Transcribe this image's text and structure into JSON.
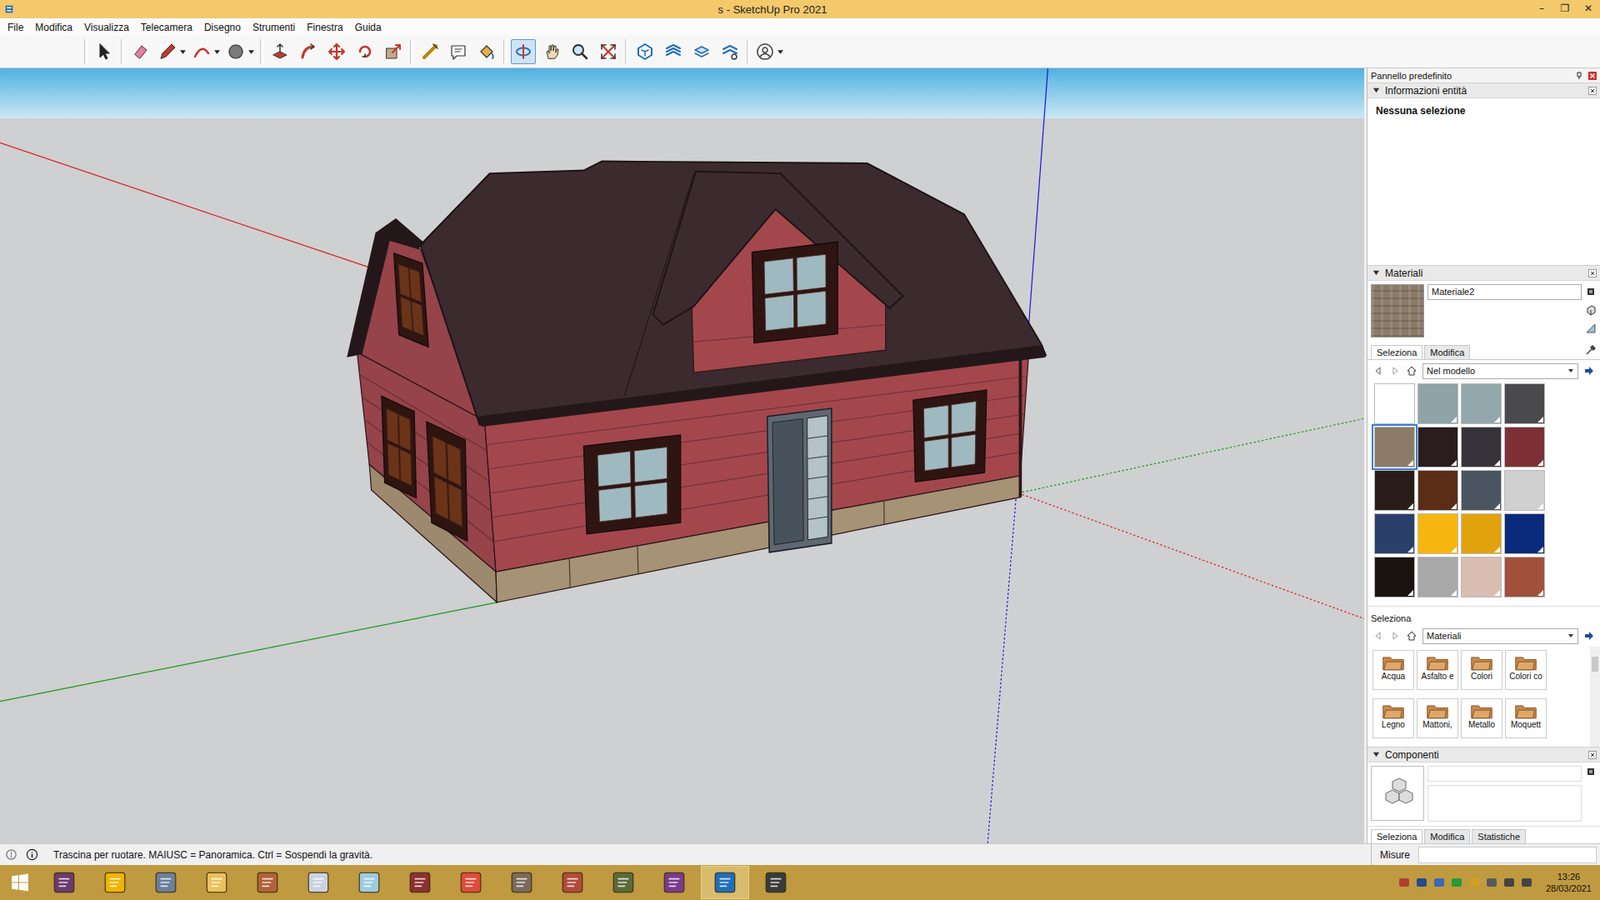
{
  "window": {
    "title": "s - SketchUp Pro 2021",
    "controls": [
      "–",
      "❐",
      "✕"
    ]
  },
  "menu": [
    "File",
    "Modifica",
    "Visualizza",
    "Telecamera",
    "Disegno",
    "Strumenti",
    "Finestra",
    "Guida"
  ],
  "toolbar": {
    "groups": [
      [
        {
          "kind": "tool",
          "selected": false
        }
      ],
      [
        {
          "kind": "tool",
          "selected": false
        },
        {
          "kind": "split",
          "selected": false
        },
        {
          "kind": "split",
          "selected": false
        },
        {
          "kind": "split",
          "selected": false
        }
      ],
      [
        {
          "kind": "tool",
          "selected": false
        },
        {
          "kind": "tool",
          "selected": false
        },
        {
          "kind": "tool",
          "selected": false
        },
        {
          "kind": "tool",
          "selected": false
        },
        {
          "kind": "tool",
          "selected": false
        }
      ],
      [
        {
          "kind": "tool",
          "selected": false
        },
        {
          "kind": "tool",
          "selected": false
        },
        {
          "kind": "tool",
          "selected": false
        }
      ],
      [
        {
          "kind": "tool",
          "selected": true
        },
        {
          "kind": "tool",
          "selected": false
        },
        {
          "kind": "tool",
          "selected": false
        },
        {
          "kind": "tool",
          "selected": false
        }
      ],
      [
        {
          "kind": "tool",
          "selected": false
        },
        {
          "kind": "tool",
          "selected": false
        },
        {
          "kind": "tool",
          "selected": false
        },
        {
          "kind": "tool",
          "selected": false
        }
      ],
      [
        {
          "kind": "split",
          "selected": false
        }
      ]
    ]
  },
  "panel": {
    "title": "Pannello predefinito",
    "entity_info": {
      "title": "Informazioni entità",
      "expanded": true,
      "text": "Nessuna selezione"
    },
    "materials": {
      "title": "Materiali",
      "expanded": true,
      "name": "Materiale2",
      "tabs": [
        {
          "label": "Seleziona",
          "selected": true
        },
        {
          "label": "Modifica",
          "selected": false
        }
      ],
      "collection": "Nel modello",
      "swatches": [
        {
          "color": "#ffffff",
          "selected": false
        },
        {
          "color": "#8fa3a8",
          "selected": false
        },
        {
          "color": "#93a8ad",
          "selected": false
        },
        {
          "color": "#4a4a4d",
          "selected": false
        },
        {
          "color": "#8b7b68",
          "selected": true
        },
        {
          "color": "#2b1c1e",
          "selected": false
        },
        {
          "color": "#37333a",
          "selected": false
        },
        {
          "color": "#7c3036",
          "selected": false
        },
        {
          "color": "#2a1c19",
          "selected": false
        },
        {
          "color": "#5b2d16",
          "selected": false
        },
        {
          "color": "#4b5561",
          "selected": false
        },
        {
          "color": "#cfcfcf",
          "selected": false
        },
        {
          "color": "#2b3f6b",
          "selected": false
        },
        {
          "color": "#f6b60f",
          "selected": false
        },
        {
          "color": "#e1a30d",
          "selected": false
        },
        {
          "color": "#0a2a7b",
          "selected": false
        },
        {
          "color": "#19140f",
          "selected": false
        },
        {
          "color": "#a9a9a9",
          "selected": false
        },
        {
          "color": "#d9bdb1",
          "selected": false
        },
        {
          "color": "#a1513b",
          "selected": false
        }
      ],
      "browser_label": "Seleziona",
      "library": "Materiali",
      "folders": [
        "Acqua",
        "Asfalto e",
        "Colori",
        "Colori co",
        "Legno",
        "Mattoni,",
        "Metallo",
        "Moquett"
      ]
    },
    "components": {
      "title": "Componenti",
      "expanded": true,
      "tabs": [
        {
          "label": "Seleziona",
          "selected": true
        },
        {
          "label": "Modifica",
          "selected": false
        },
        {
          "label": "Statistiche",
          "selected": false
        }
      ]
    }
  },
  "status_bar": {
    "hint": "Trascina per ruotare. MAIUSC = Panoramica. Ctrl = Sospendi la gravità.",
    "measure_label": "Misure"
  },
  "taskbar": {
    "apps": [
      {
        "active": false
      },
      {
        "active": false
      },
      {
        "active": false
      },
      {
        "active": false
      },
      {
        "active": false
      },
      {
        "active": false
      },
      {
        "active": false
      },
      {
        "active": false
      },
      {
        "active": false
      },
      {
        "active": false
      },
      {
        "active": false
      },
      {
        "active": false
      },
      {
        "active": false
      },
      {
        "active": true
      },
      {
        "active": false
      }
    ],
    "time": "13:26",
    "date": "28/03/2021"
  }
}
